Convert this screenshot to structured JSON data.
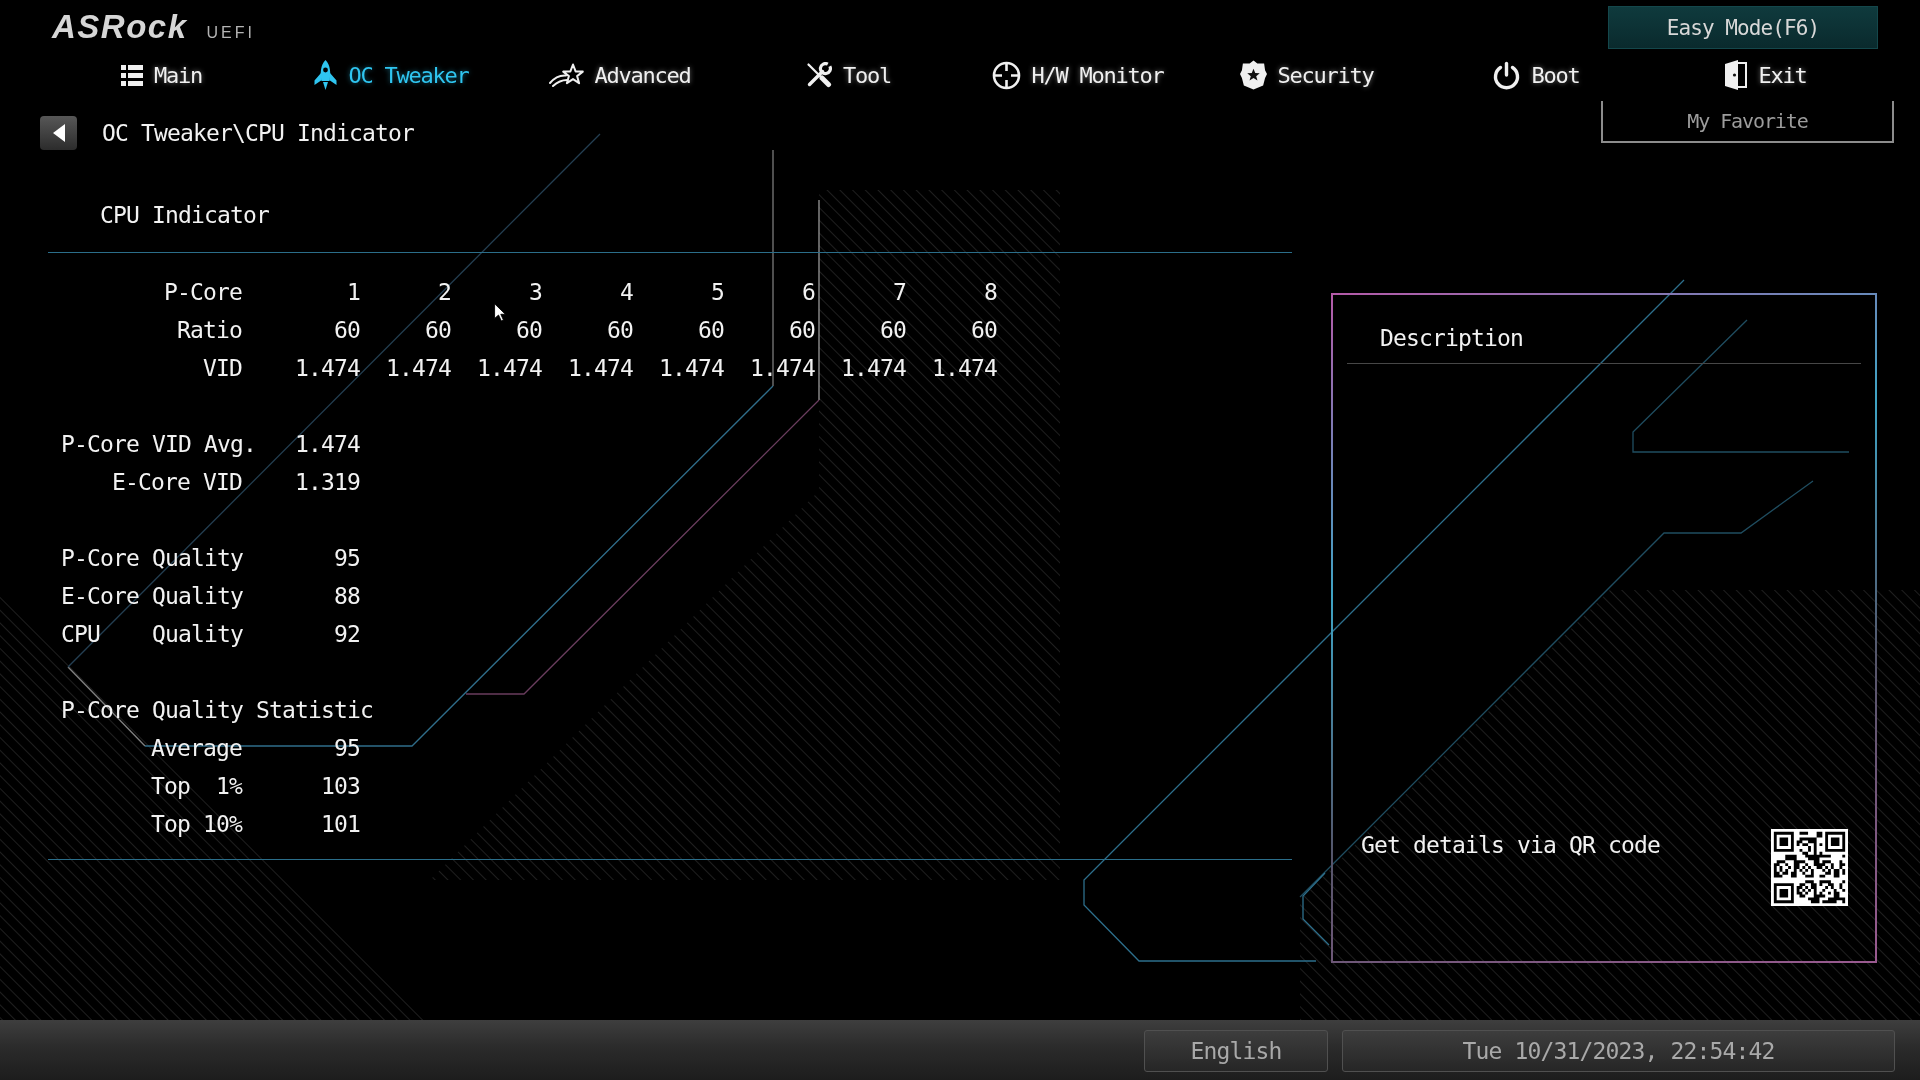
{
  "header": {
    "logo": "ASRock",
    "logo_suffix": "UEFI",
    "easy_mode_button": "Easy Mode(F6)"
  },
  "nav": {
    "tabs": [
      {
        "label": "Main",
        "selected": false
      },
      {
        "label": "OC Tweaker",
        "selected": true
      },
      {
        "label": "Advanced",
        "selected": false
      },
      {
        "label": "Tool",
        "selected": false
      },
      {
        "label": "H/W Monitor",
        "selected": false
      },
      {
        "label": "Security",
        "selected": false
      },
      {
        "label": "Boot",
        "selected": false
      },
      {
        "label": "Exit",
        "selected": false
      }
    ]
  },
  "breadcrumb": "OC Tweaker\\CPU Indicator",
  "favorite_button": "My Favorite",
  "section": {
    "title": "CPU Indicator",
    "core_table": {
      "rows": [
        {
          "label": "P-Core",
          "values": [
            "1",
            "2",
            "3",
            "4",
            "5",
            "6",
            "7",
            "8"
          ]
        },
        {
          "label": "Ratio",
          "values": [
            "60",
            "60",
            "60",
            "60",
            "60",
            "60",
            "60",
            "60"
          ]
        },
        {
          "label": "VID",
          "values": [
            "1.474",
            "1.474",
            "1.474",
            "1.474",
            "1.474",
            "1.474",
            "1.474",
            "1.474"
          ]
        }
      ]
    },
    "groups": [
      {
        "rows": [
          {
            "label": "P-Core VID Avg.",
            "value": "1.474"
          },
          {
            "label": "E-Core VID",
            "value": "1.319"
          }
        ]
      },
      {
        "rows": [
          {
            "label": "P-Core Quality",
            "value": "95"
          },
          {
            "label": "E-Core Quality",
            "value": "88"
          },
          {
            "label": "CPU    Quality",
            "value": "92"
          }
        ]
      },
      {
        "title": "P-Core Quality Statistic",
        "rows": [
          {
            "label": "Average",
            "value": "95"
          },
          {
            "label": "Top  1%",
            "value": "103"
          },
          {
            "label": "Top 10%",
            "value": "101"
          }
        ]
      }
    ]
  },
  "description_panel": {
    "title": "Description",
    "qr_hint": "Get details via QR code"
  },
  "status_bar": {
    "language": "English",
    "datetime": "Tue 10/31/2023, 22:54:42"
  }
}
